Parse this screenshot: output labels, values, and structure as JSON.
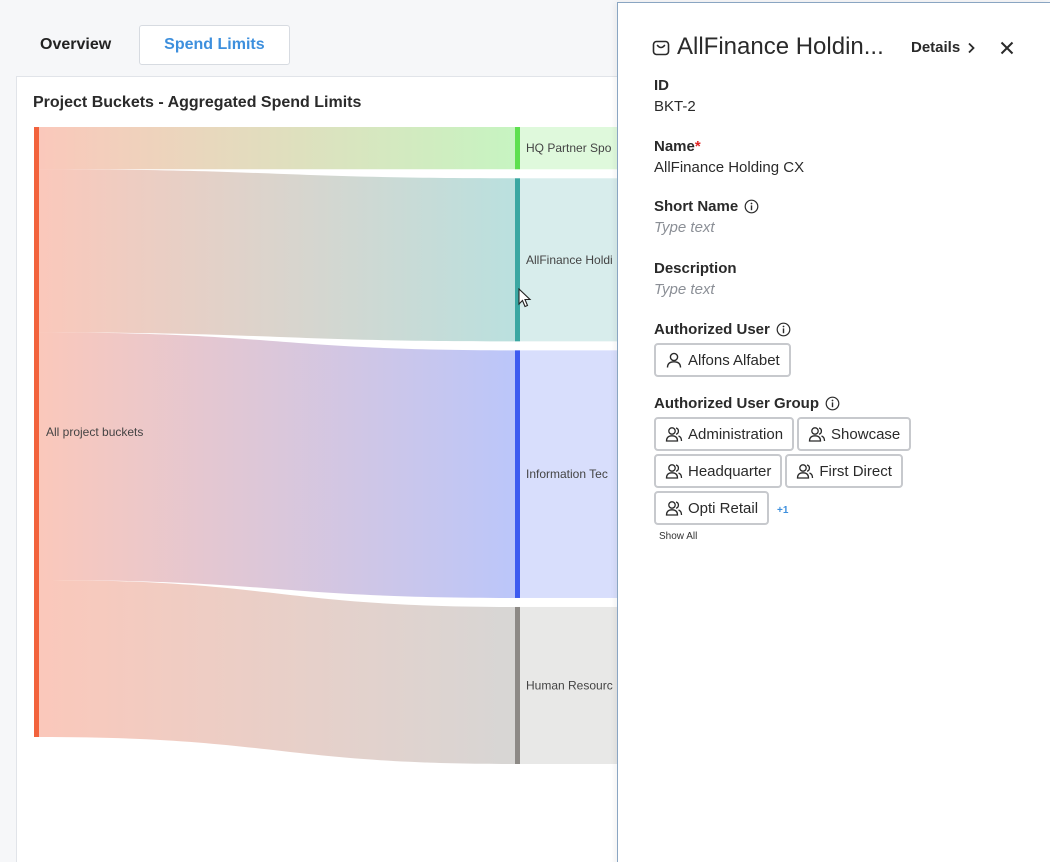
{
  "tabs": [
    {
      "label": "Overview",
      "active": false
    },
    {
      "label": "Spend Limits",
      "active": true
    }
  ],
  "chart_card": {
    "title": "Project Buckets - Aggregated Spend Limits"
  },
  "chart_data": {
    "type": "sankey",
    "title": "Project Buckets - Aggregated Spend Limits",
    "nodes": [
      {
        "id": "all",
        "label": "All project buckets",
        "color": "#f2623c"
      },
      {
        "id": "hq",
        "label": "HQ Partner Spo",
        "color": "#5ee04f"
      },
      {
        "id": "afh",
        "label": "AllFinance Holdi",
        "color": "#3aa7a2"
      },
      {
        "id": "it",
        "label": "Information Tec",
        "color": "#3d5bf0"
      },
      {
        "id": "hr",
        "label": "Human Resourc",
        "color": "#8d8a86"
      }
    ],
    "links": [
      {
        "source": "all",
        "target": "hq",
        "value": 7
      },
      {
        "source": "all",
        "target": "afh",
        "value": 27
      },
      {
        "source": "all",
        "target": "it",
        "value": 41
      },
      {
        "source": "all",
        "target": "hr",
        "value": 26
      }
    ]
  },
  "drawer": {
    "title": "AllFinance Holdin...",
    "details_label": "Details",
    "fields": {
      "id": {
        "label": "ID",
        "value": "BKT-2"
      },
      "name": {
        "label": "Name",
        "required_mark": "*",
        "value": "AllFinance Holding CX"
      },
      "short_name": {
        "label": "Short Name",
        "placeholder": "Type text"
      },
      "description": {
        "label": "Description",
        "placeholder": "Type text"
      },
      "authorized_user": {
        "label": "Authorized User",
        "users": [
          "Alfons Alfabet"
        ]
      },
      "authorized_user_group": {
        "label": "Authorized User Group",
        "groups": [
          "Administration",
          "Showcase",
          "Headquarter",
          "First Direct",
          "Opti Retail"
        ],
        "more_count": "+1",
        "show_all_label": "Show All"
      }
    }
  }
}
